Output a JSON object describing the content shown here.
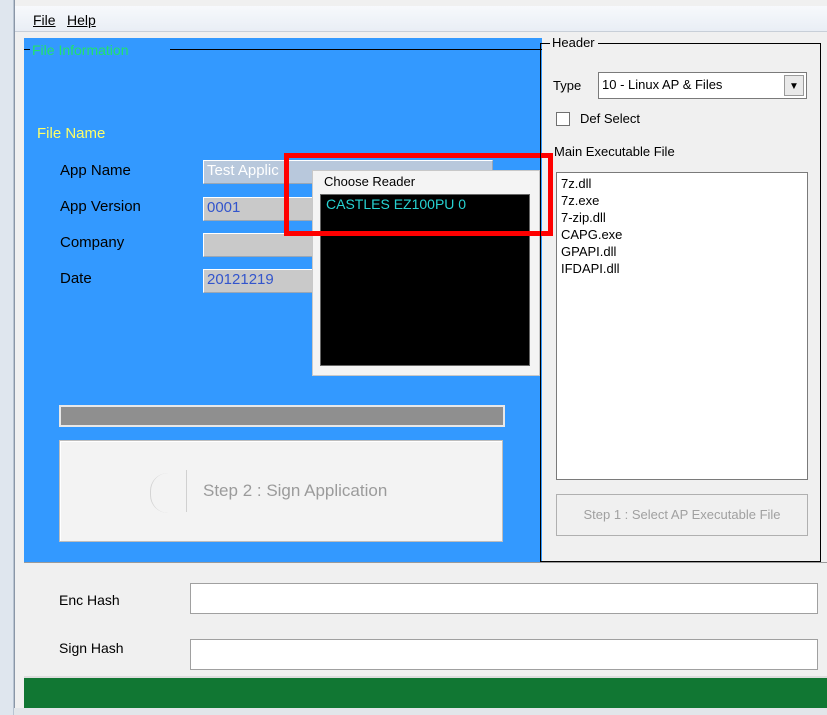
{
  "menu": {
    "file": "File",
    "help": "Help"
  },
  "file_info": {
    "legend": "File Information",
    "file_name_heading": "File Name",
    "app_name_label": "App Name",
    "app_name_value": "Test Applic",
    "app_version_label": "App Version",
    "app_version_value": "0001",
    "company_label": "Company",
    "company_value": "",
    "date_label": "Date",
    "date_value": "20121219"
  },
  "reader_popup": {
    "legend": "Choose Reader",
    "items": [
      "CASTLES EZ100PU 0"
    ]
  },
  "progress": {
    "value": 0
  },
  "step2_button": {
    "label": "Step 2 : Sign Application"
  },
  "header_group": {
    "legend": "Header",
    "type_label": "Type",
    "type_value": "10 - Linux AP & Files",
    "def_select_label": "Def Select",
    "def_select_checked": false,
    "main_exe_label": "Main Executable File",
    "files": [
      "7z.dll",
      "7z.exe",
      "7-zip.dll",
      "CAPG.exe",
      "GPAPI.dll",
      "IFDAPI.dll"
    ],
    "step1_label": "Step 1 : Select AP Executable File"
  },
  "hashes": {
    "enc_label": "Enc Hash",
    "enc_value": "",
    "sign_label": "Sign Hash",
    "sign_value": ""
  },
  "colors": {
    "panel_blue": "#3399ff",
    "legend_green": "#22e36a",
    "heading_yellow": "#ffff66",
    "reader_text": "#27d3d3",
    "highlight_red": "#ff0000",
    "status_green": "#117733"
  }
}
